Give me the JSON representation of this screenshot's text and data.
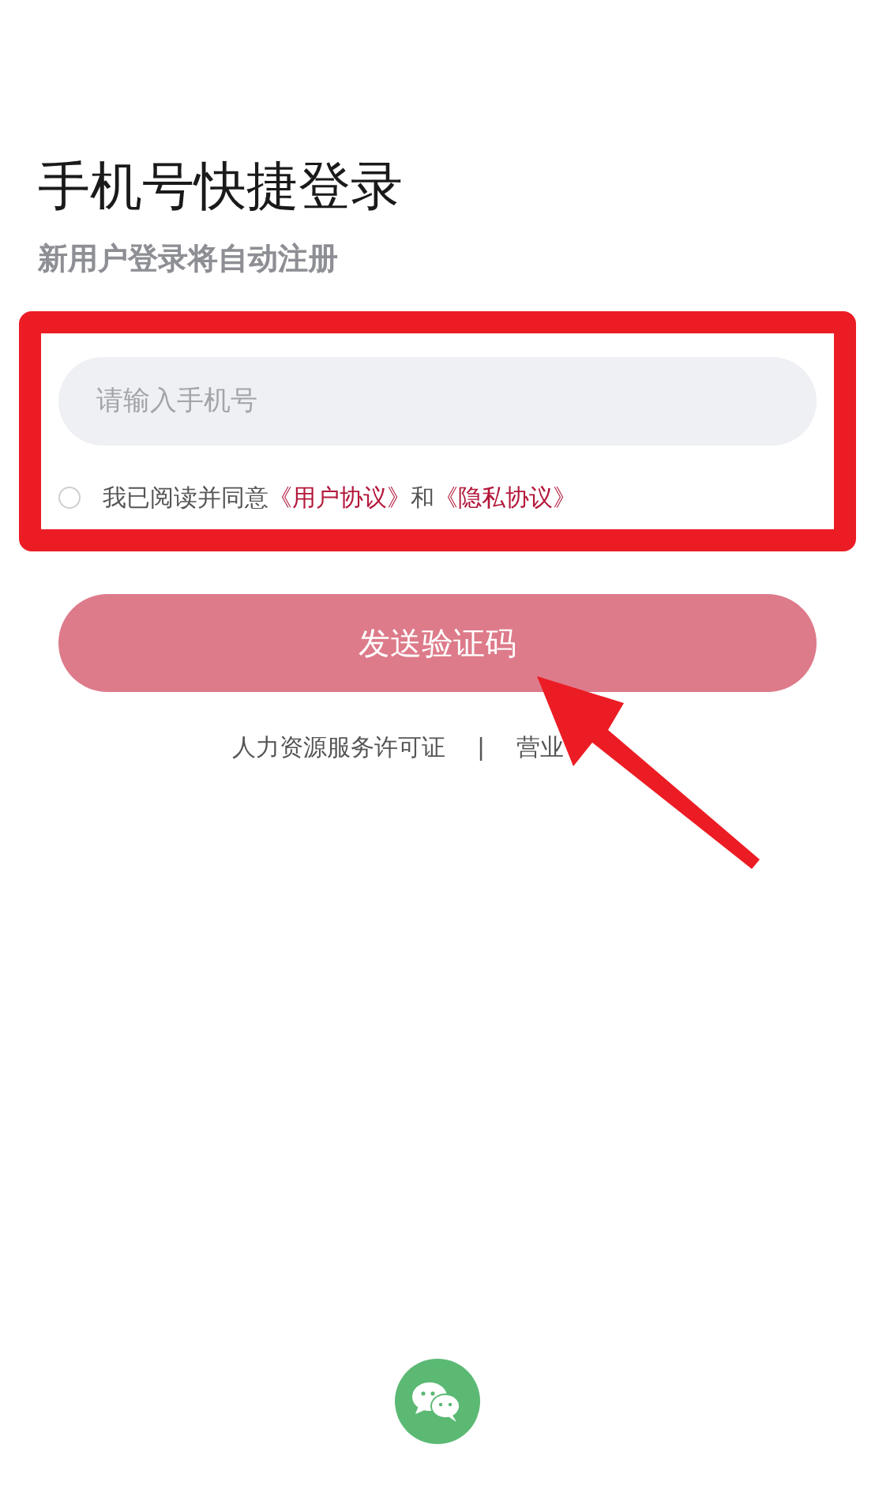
{
  "title": "手机号快捷登录",
  "subtitle": "新用户登录将自动注册",
  "phone_field": {
    "placeholder": "请输入手机号"
  },
  "agreement": {
    "checked": false,
    "text": "我已阅读并同意",
    "links": [
      "《用户协议》",
      "《隐私协议》"
    ],
    "joiner": "和"
  },
  "send_button": {
    "label": "发送验证码",
    "disabled": true
  },
  "footer_links": [
    "人力资源服务许可证",
    "营业"
  ],
  "footer_separator": "|"
}
